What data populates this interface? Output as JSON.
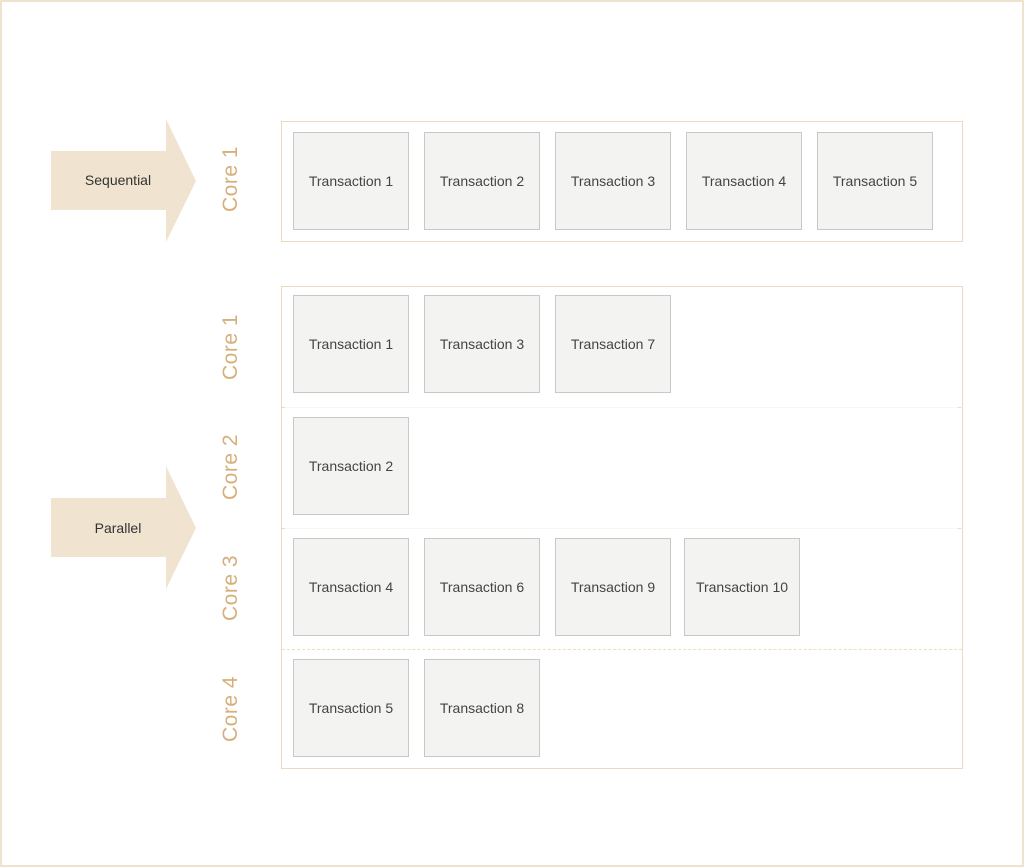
{
  "colors": {
    "arrow_fill": "#f0e3cf",
    "core_label": "#d6b07a",
    "group_border": "#efd8bd",
    "transaction_fill": "#f3f3f2",
    "transaction_border": "#c8c8c8"
  },
  "sequential": {
    "arrow_label": "Sequential",
    "cores": [
      {
        "label": "Core 1",
        "transactions": [
          "Transaction 1",
          "Transaction 2",
          "Transaction 3",
          "Transaction 4",
          "Transaction 5"
        ]
      }
    ]
  },
  "parallel": {
    "arrow_label": "Parallel",
    "cores": [
      {
        "label": "Core 1",
        "transactions": [
          "Transaction 1",
          "Transaction 3",
          "Transaction 7"
        ]
      },
      {
        "label": "Core 2",
        "transactions": [
          "Transaction 2"
        ]
      },
      {
        "label": "Core 3",
        "transactions": [
          "Transaction 4",
          "Transaction 6",
          "Transaction 9",
          "Transaction 10"
        ]
      },
      {
        "label": "Core 4",
        "transactions": [
          "Transaction 5",
          "Transaction 8"
        ]
      }
    ]
  }
}
